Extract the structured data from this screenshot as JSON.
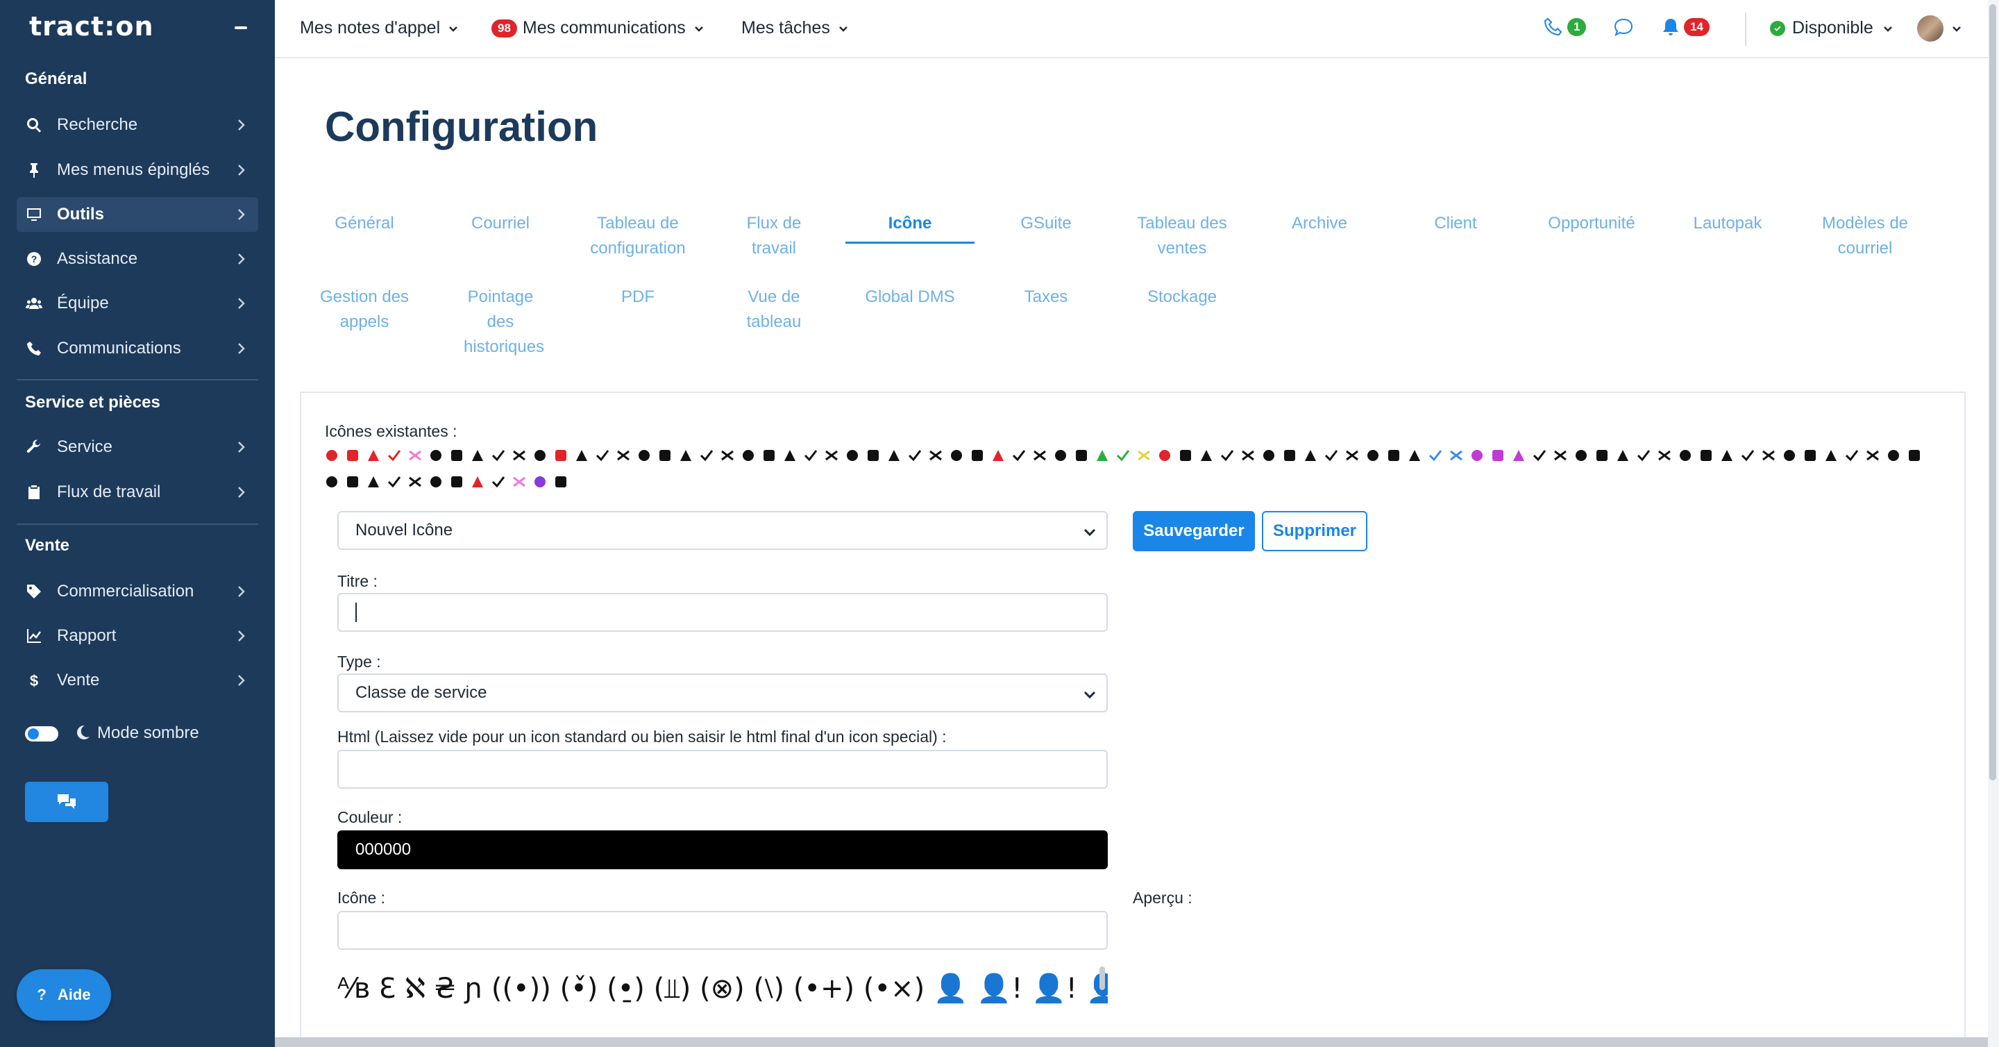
{
  "sidebar": {
    "logo": "tract:on",
    "sections": [
      {
        "title": "Général",
        "items": [
          {
            "label": "Recherche",
            "icon": "search-icon"
          },
          {
            "label": "Mes menus épinglés",
            "icon": "pin-icon"
          },
          {
            "label": "Outils",
            "icon": "desktop-icon",
            "active": true
          },
          {
            "label": "Assistance",
            "icon": "question-circle-icon"
          },
          {
            "label": "Équipe",
            "icon": "users-icon"
          },
          {
            "label": "Communications",
            "icon": "phone-icon"
          }
        ]
      },
      {
        "title": "Service et pièces",
        "items": [
          {
            "label": "Service",
            "icon": "wrench-icon"
          },
          {
            "label": "Flux de travail",
            "icon": "clipboard-icon"
          }
        ]
      },
      {
        "title": "Vente",
        "items": [
          {
            "label": "Commercialisation",
            "icon": "tag-icon"
          },
          {
            "label": "Rapport",
            "icon": "chart-line-icon"
          },
          {
            "label": "Vente",
            "icon": "dollar-icon"
          }
        ]
      }
    ],
    "dark_mode_label": "Mode sombre",
    "help_label": "Aide"
  },
  "topbar": {
    "call_notes": "Mes notes d'appel",
    "communications": "Mes communications",
    "communications_badge": "98",
    "tasks": "Mes tâches",
    "phone_badge": "1",
    "bell_badge": "14",
    "status": "Disponible"
  },
  "page": {
    "title": "Configuration",
    "tabs_row1": [
      {
        "label": "Général"
      },
      {
        "label": "Courriel"
      },
      {
        "label": "Tableau de configuration"
      },
      {
        "label": "Flux de travail"
      },
      {
        "label": "Icône",
        "active": true
      },
      {
        "label": "GSuite"
      },
      {
        "label": "Tableau des ventes"
      },
      {
        "label": "Archive"
      },
      {
        "label": "Client"
      },
      {
        "label": "Opportunité"
      },
      {
        "label": "Lautopak"
      },
      {
        "label": "Modèles de courriel"
      }
    ],
    "tabs_row2": [
      {
        "label": "Gestion des appels"
      },
      {
        "label": "Pointage des historiques"
      },
      {
        "label": "PDF"
      },
      {
        "label": "Vue de tableau"
      },
      {
        "label": "Global DMS"
      },
      {
        "label": "Taxes"
      },
      {
        "label": "Stockage"
      }
    ]
  },
  "form": {
    "existing_icons_label": "Icônes existantes :",
    "icon_select_value": "Nouvel Icône",
    "save_label": "Sauvegarder",
    "delete_label": "Supprimer",
    "title_label": "Titre :",
    "title_value": "",
    "type_label": "Type :",
    "type_value": "Classe de service",
    "html_label": "Html (Laissez vide pour un icon standard ou bien saisir le html final d'un icon special) :",
    "html_value": "",
    "color_label": "Couleur :",
    "color_value": "000000",
    "icon_label": "Icône :",
    "icon_value": "",
    "preview_label": "Aperçu :"
  },
  "colors": {
    "sidebar_bg": "#1d3a5b",
    "accent": "#1a86e8",
    "badge_red": "#e0242a",
    "status_green": "#2cab3e"
  }
}
